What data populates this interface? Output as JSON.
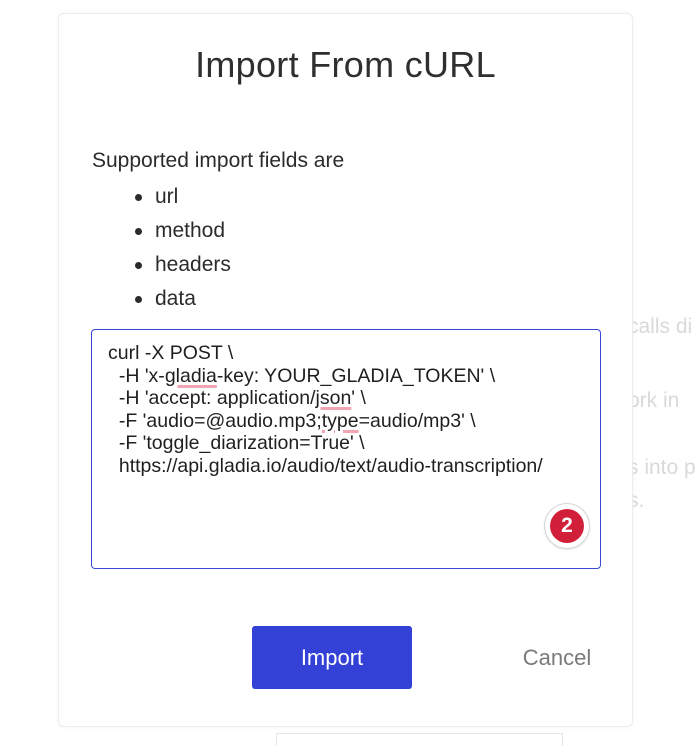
{
  "background": {
    "fragments": [
      "calls di",
      "ork in",
      "s into p",
      "s."
    ]
  },
  "dialog": {
    "title": "Import From cURL",
    "fields_intro": "Supported import fields are",
    "fields": [
      "url",
      "method",
      "headers",
      "data"
    ],
    "curl": {
      "line1": "curl -X POST \\",
      "line2_a": "  -H 'x-",
      "line2_b": "gladia",
      "line2_c": "-key: YOUR_GLADIA_TOKEN' \\",
      "line3_a": "  -H 'accept: application/",
      "line3_b": "json",
      "line3_c": "' \\",
      "line4_a": "  -F 'audio=@audio.mp3;",
      "line4_b": "type",
      "line4_c": "=audio/mp3' \\",
      "line5": "  -F 'toggle_diarization=True' \\",
      "line6": "  https://api.gladia.io/audio/text/audio-transcription/"
    },
    "badge_count": "2",
    "import_label": "Import",
    "cancel_label": "Cancel"
  },
  "colors": {
    "primary": "#3341d6",
    "focus_border": "#3a47d5",
    "badge": "#d11f3a",
    "spellcheck": "#f1a4b1"
  }
}
